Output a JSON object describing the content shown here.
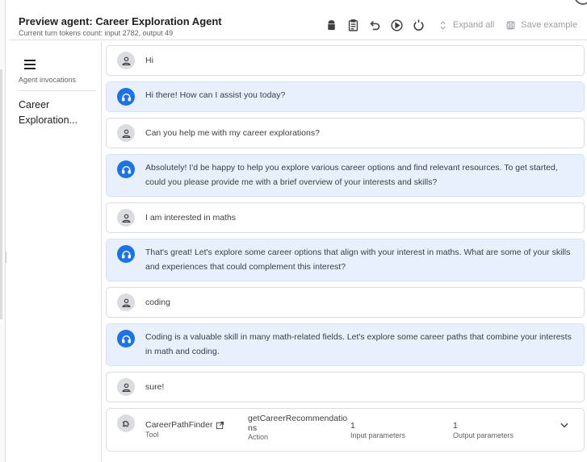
{
  "header": {
    "title": "Preview agent: Career Exploration Agent",
    "tokens": "Current turn tokens count: input 2782, output 49"
  },
  "toolbar": {
    "icons": [
      "android-icon",
      "clipboard-icon",
      "undo-icon",
      "play-circle-icon",
      "reset-icon"
    ],
    "expand_all": "Expand all",
    "save_example": "Save example"
  },
  "sidebar": {
    "label": "Agent invocations",
    "item": "Career Exploration..."
  },
  "messages": [
    {
      "role": "user",
      "text": "Hi"
    },
    {
      "role": "agent",
      "text": "Hi there! How can I assist you today?"
    },
    {
      "role": "user",
      "text": "Can you help me with my career explorations?"
    },
    {
      "role": "agent",
      "text": "Absolutely! I'd be happy to help you explore various career options and find relevant resources. To get started, could you please provide me with a brief overview of your interests and skills?"
    },
    {
      "role": "user",
      "text": "I am interested in maths"
    },
    {
      "role": "agent",
      "text": "That's great! Let's explore some career options that align with your interest in maths. What are some of your skills and experiences that could complement this interest?"
    },
    {
      "role": "user",
      "text": "coding"
    },
    {
      "role": "agent",
      "text": "Coding is a valuable skill in many math-related fields. Let's explore some career paths that combine your interests in math and coding."
    },
    {
      "role": "user",
      "text": "sure!"
    }
  ],
  "tool_call": {
    "tool_name": "CareerPathFinder",
    "tool_label": "Tool",
    "action_name": "getCareerRecommendations",
    "action_label": "Action",
    "input_count": "1",
    "input_label": "Input parameters",
    "output_count": "1",
    "output_label": "Output parameters"
  }
}
